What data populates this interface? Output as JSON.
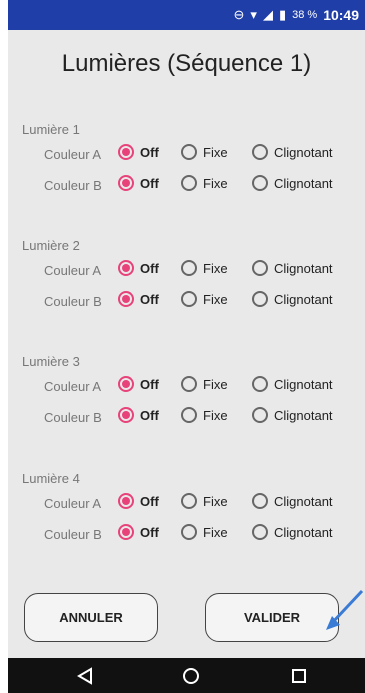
{
  "status": {
    "battery_pct": "38 %",
    "time": "10:49"
  },
  "title": "Lumières (Séquence 1)",
  "options": [
    "Off",
    "Fixe",
    "Clignotant"
  ],
  "lights": [
    {
      "name": "Lumière 1",
      "rows": [
        {
          "label": "Couleur A",
          "selected": "Off"
        },
        {
          "label": "Couleur B",
          "selected": "Off"
        }
      ]
    },
    {
      "name": "Lumière 2",
      "rows": [
        {
          "label": "Couleur A",
          "selected": "Off"
        },
        {
          "label": "Couleur B",
          "selected": "Off"
        }
      ]
    },
    {
      "name": "Lumière 3",
      "rows": [
        {
          "label": "Couleur A",
          "selected": "Off"
        },
        {
          "label": "Couleur B",
          "selected": "Off"
        }
      ]
    },
    {
      "name": "Lumière 4",
      "rows": [
        {
          "label": "Couleur A",
          "selected": "Off"
        },
        {
          "label": "Couleur B",
          "selected": "Off"
        }
      ]
    }
  ],
  "buttons": {
    "cancel": "ANNULER",
    "confirm": "VALIDER"
  },
  "colors": {
    "accent": "#e8427a",
    "status_bar": "#1f3ea8",
    "background": "#e9e9e9"
  }
}
